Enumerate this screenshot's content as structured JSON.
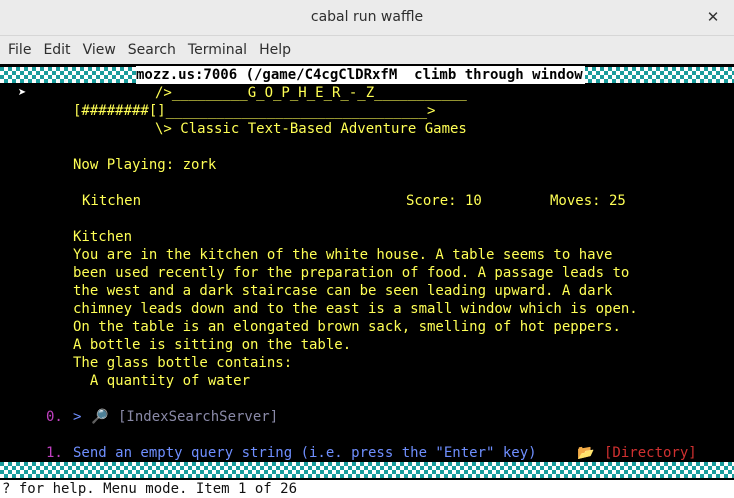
{
  "window": {
    "title": "cabal run waffle"
  },
  "menu": [
    "File",
    "Edit",
    "View",
    "Search",
    "Terminal",
    "Help"
  ],
  "header_path": "mozz.us:7006 (/game/C4cgClDRxfM  climb through window",
  "banner": {
    "line1": "/>_________G_O_P_H_E_R_-_Z___________",
    "line2": "[########[]_______________________________>",
    "line3": "\\> Classic Text-Based Adventure Games"
  },
  "now_playing": "Now Playing: zork",
  "room_status": {
    "room": "Kitchen",
    "score": "Score: 10",
    "moves": "Moves: 25"
  },
  "description": [
    "Kitchen",
    "You are in the kitchen of the white house. A table seems to have",
    "been used recently for the preparation of food. A passage leads to",
    "the west and a dark staircase can be seen leading upward. A dark",
    "chimney leads down and to the east is a small window which is open.",
    "On the table is an elongated brown sack, smelling of hot peppers.",
    "A bottle is sitting on the table.",
    "The glass bottle contains:",
    "  A quantity of water"
  ],
  "items": [
    {
      "index": "0.",
      "arrow": ">",
      "icon": "magnifier-icon",
      "label": "[IndexSearchServer]"
    },
    {
      "index": "1.",
      "text": "Send an empty query string (i.e. press the \"Enter\" key)",
      "icon": "folder-icon",
      "label": "[Directory]"
    }
  ],
  "cursor_glyph": "➤",
  "status_line": "? for help. Menu mode. Item 1 of 26"
}
